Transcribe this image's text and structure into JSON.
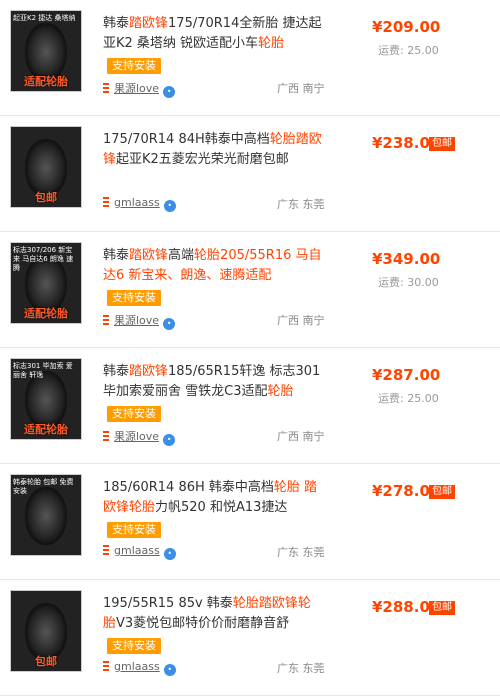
{
  "items": [
    {
      "title_parts": [
        "韩泰",
        "踏欧锋",
        "175/70R14全新胎 捷达起亚K2 桑塔纳 锐欧适配小车",
        "轮胎"
      ],
      "thumb_caption": "起亚K2 捷达 桑塔纳",
      "thumb_badge": "适配轮胎",
      "tag": "支持安装",
      "seller": "果源love",
      "location": "广西 南宁",
      "price": "¥209.00",
      "freight": "运费: 25.00",
      "baoyou": ""
    },
    {
      "title_parts": [
        "175/70R14 84H韩泰中高档",
        "轮胎踏欧锋",
        "起亚K2五菱宏光荣光耐磨包邮",
        ""
      ],
      "thumb_caption": "",
      "thumb_badge": "包邮",
      "tag": "",
      "seller": "gmlaass",
      "location": "广东 东莞",
      "price": "¥238.00",
      "freight": "",
      "baoyou": "包邮"
    },
    {
      "title_parts": [
        "韩泰",
        "踏欧锋",
        "高端",
        "轮胎205/55R16 马自达6 新宝来、朗逸、速腾适配"
      ],
      "thumb_caption": "标志307/206 新宝来 马自达6 朗逸 速腾",
      "thumb_badge": "适配轮胎",
      "tag": "支持安装",
      "seller": "果源love",
      "location": "广西 南宁",
      "price": "¥349.00",
      "freight": "运费: 30.00",
      "baoyou": ""
    },
    {
      "title_parts": [
        "韩泰",
        "踏欧锋",
        "185/65R15轩逸 标志301毕加索爱丽舍 雪铁龙C3适配",
        "轮胎"
      ],
      "thumb_caption": "标志301 毕加索 爱丽舍 轩逸",
      "thumb_badge": "适配轮胎",
      "tag": "支持安装",
      "seller": "果源love",
      "location": "广西 南宁",
      "price": "¥287.00",
      "freight": "运费: 25.00",
      "baoyou": ""
    },
    {
      "title_parts": [
        "185/60R14 86H 韩泰中高档",
        "轮胎 踏欧锋轮胎",
        "力帆520 和悦A13捷达",
        ""
      ],
      "thumb_caption": "韩泰轮胎 包邮 免费安装",
      "thumb_badge": "",
      "tag": "支持安装",
      "seller": "gmlaass",
      "location": "广东 东莞",
      "price": "¥278.00",
      "freight": "",
      "baoyou": "包邮"
    },
    {
      "title_parts": [
        "195/55R15 85v 韩泰",
        "轮胎踏欧锋轮胎",
        "V3菱悦包邮特价价耐磨静音舒",
        ""
      ],
      "thumb_caption": "",
      "thumb_badge": "包邮",
      "tag": "支持安装",
      "seller": "gmlaass",
      "location": "广东 东莞",
      "price": "¥288.00",
      "freight": "",
      "baoyou": "包邮"
    }
  ]
}
